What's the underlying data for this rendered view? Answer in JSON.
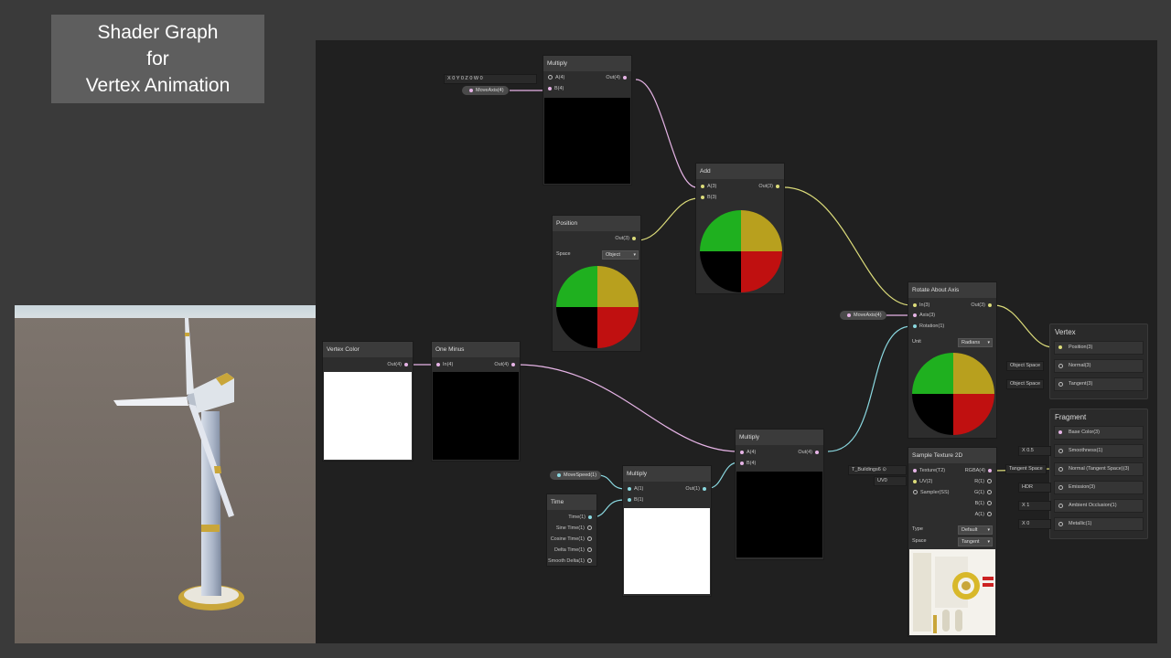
{
  "slide": {
    "title_lines": [
      "Shader Graph",
      "for",
      "Vertex Animation"
    ]
  },
  "colors": {
    "wire_vec3": "#dcdc7a",
    "wire_vec4": "#e6b4e6",
    "wire_float": "#8ad8e0",
    "canvas_bg": "#202020"
  },
  "nodes": {
    "multiply_top": {
      "title": "Multiply",
      "in_a": "A(4)",
      "in_b": "B(4)",
      "out": "Out(4)"
    },
    "vec_input": {
      "x_label": "X",
      "x_val": "0",
      "y_label": "Y",
      "y_val": "0",
      "z_label": "Z",
      "z_val": "0",
      "w_label": "W",
      "w_val": "0"
    },
    "move_axis_prop": {
      "label": "MoveAxis(4)"
    },
    "add": {
      "title": "Add",
      "in_a": "A(3)",
      "in_b": "B(3)",
      "out": "Out(3)"
    },
    "position": {
      "title": "Position",
      "out": "Out(3)",
      "space_label": "Space",
      "space_value": "Object"
    },
    "rotate": {
      "title": "Rotate About Axis",
      "in": "In(3)",
      "axis": "Axis(3)",
      "rotation": "Rotation(1)",
      "out": "Out(3)",
      "unit_label": "Unit",
      "unit_value": "Radians"
    },
    "move_axis_prop2": {
      "label": "MoveAxis(4)"
    },
    "vertex_color": {
      "title": "Vertex Color",
      "out": "Out(4)"
    },
    "one_minus": {
      "title": "One Minus",
      "in": "In(4)",
      "out": "Out(4)"
    },
    "multiply_mid": {
      "title": "Multiply",
      "in_a": "A(4)",
      "in_b": "B(4)",
      "out": "Out(4)"
    },
    "multiply_low": {
      "title": "Multiply",
      "in_a": "A(1)",
      "in_b": "B(1)",
      "out": "Out(1)"
    },
    "move_speed_prop": {
      "label": "MoveSpeed(1)"
    },
    "time": {
      "title": "Time",
      "outputs": [
        "Time(1)",
        "Sine Time(1)",
        "Cosine Time(1)",
        "Delta Time(1)",
        "Smooth Delta(1)"
      ]
    },
    "sample_tex": {
      "title": "Sample Texture 2D",
      "in_tex": "Texture(T2)",
      "in_uv": "UV(2)",
      "in_sampler": "Sampler(SS)",
      "outputs": [
        "RGBA(4)",
        "R(1)",
        "G(1)",
        "B(1)",
        "A(1)"
      ],
      "type_label": "Type",
      "type_value": "Default",
      "space_label": "Space",
      "space_value": "Tangent"
    },
    "tex_input": {
      "label": "T_Buildings6 ⊙"
    },
    "uv_input": {
      "label": "UV0"
    }
  },
  "vertex_ctx": {
    "title": "Vertex",
    "slots": [
      "Position(3)",
      "Normal(3)",
      "Tangent(3)"
    ],
    "normal_input": "Object Space",
    "tangent_input": "Object Space"
  },
  "fragment_ctx": {
    "title": "Fragment",
    "slots": [
      "Base Color(3)",
      "Smoothness(1)",
      "Normal (Tangent Space)(3)",
      "Emission(3)",
      "Ambient Occlusion(1)",
      "Metallic(1)"
    ],
    "smooth_x": "X",
    "smooth_val": "0.5",
    "normal_input": "Tangent Space",
    "emission_input": "HDR",
    "ao_x": "X",
    "ao_val": "1",
    "metal_x": "X",
    "metal_val": "0"
  }
}
